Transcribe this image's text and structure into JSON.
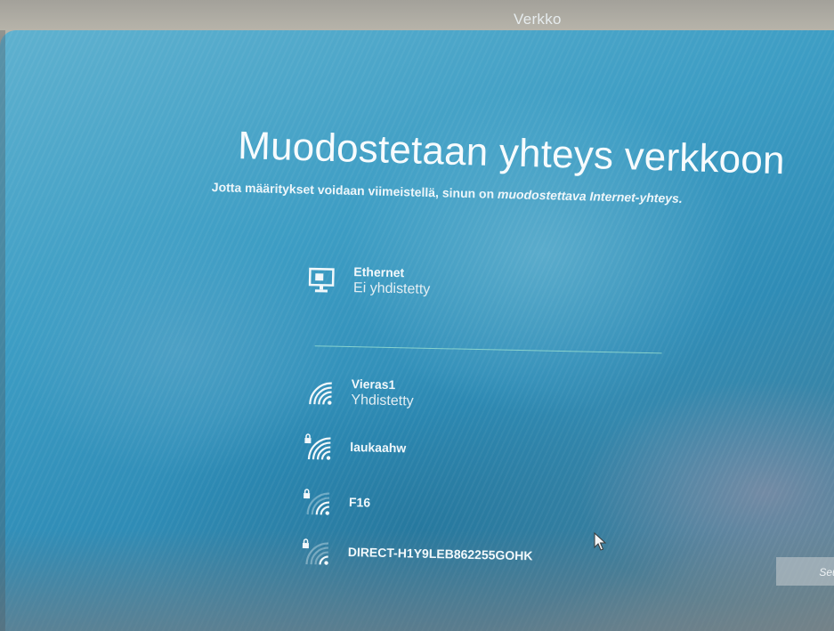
{
  "window": {
    "title": "Verkko"
  },
  "header": {
    "title": "Muodostetaan yhteys verkkoon",
    "subtitle_part1": "Jotta määritykset voidaan viimeistellä, sinun on ",
    "subtitle_part2": "muodostettava Internet-yhteys."
  },
  "ethernet": {
    "name": "Ethernet",
    "status": "Ei yhdistetty",
    "icon": "ethernet-monitor-icon"
  },
  "wifi_networks": [
    {
      "name": "Vieras1",
      "status": "Yhdistetty",
      "secured": false,
      "icon": "wifi-signal-icon"
    },
    {
      "name": "laukaahw",
      "status": "",
      "secured": true,
      "icon": "wifi-secured-icon"
    },
    {
      "name": "F16",
      "status": "",
      "secured": true,
      "icon": "wifi-secured-icon"
    },
    {
      "name": "DIRECT-H1Y9LEB862255GOHK",
      "status": "",
      "secured": true,
      "icon": "wifi-secured-icon"
    }
  ],
  "footer": {
    "next_label": "Seu"
  },
  "colors": {
    "screen_blue": "#3d9dc4",
    "text": "#f7fbfd",
    "separator": "#a0e6d2"
  }
}
